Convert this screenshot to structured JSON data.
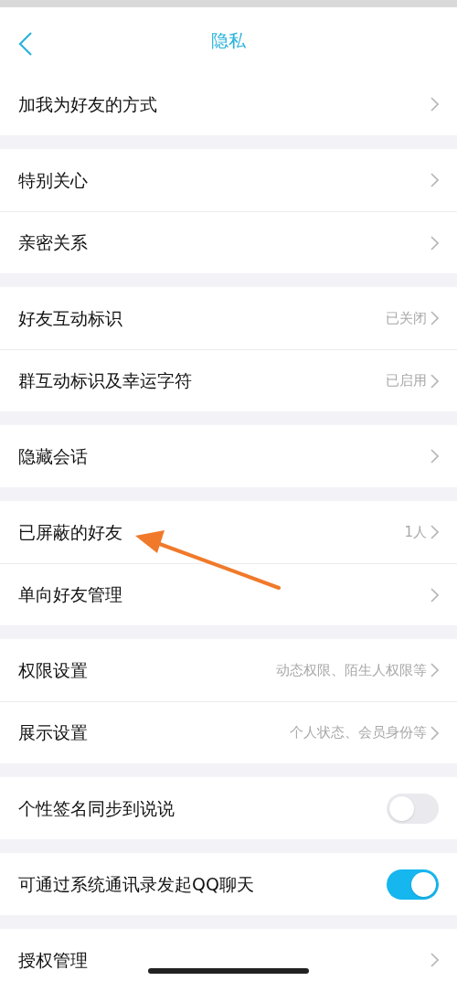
{
  "header": {
    "title": "隐私"
  },
  "sections": [
    [
      {
        "kind": "link",
        "label": "加我为好友的方式"
      }
    ],
    [
      {
        "kind": "link",
        "label": "特别关心"
      },
      {
        "kind": "link",
        "label": "亲密关系"
      }
    ],
    [
      {
        "kind": "link",
        "label": "好友互动标识",
        "value": "已关闭"
      },
      {
        "kind": "link",
        "label": "群互动标识及幸运字符",
        "value": "已启用"
      }
    ],
    [
      {
        "kind": "link",
        "label": "隐藏会话"
      }
    ],
    [
      {
        "kind": "link",
        "label": "已屏蔽的好友",
        "value": "1人"
      },
      {
        "kind": "link",
        "label": "单向好友管理"
      }
    ],
    [
      {
        "kind": "link",
        "label": "权限设置",
        "value": "动态权限、陌生人权限等"
      },
      {
        "kind": "link",
        "label": "展示设置",
        "value": "个人状态、会员身份等"
      }
    ],
    [
      {
        "kind": "toggle",
        "label": "个性签名同步到说说",
        "on": false
      }
    ],
    [
      {
        "kind": "toggle",
        "label": "可通过系统通讯录发起QQ聊天",
        "on": true
      }
    ],
    [
      {
        "kind": "link",
        "label": "授权管理"
      }
    ]
  ]
}
